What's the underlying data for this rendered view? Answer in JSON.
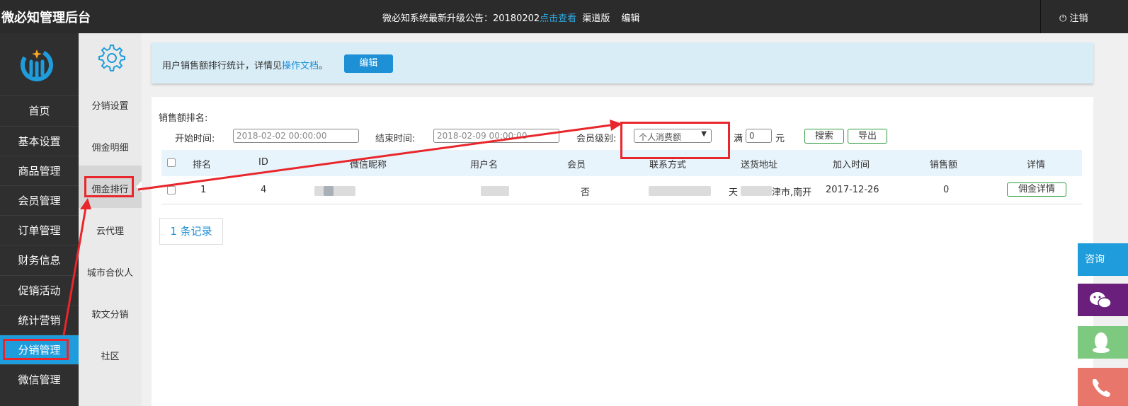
{
  "header": {
    "brand": "微必知管理后台",
    "notice_prefix": "微必知系统最新升级公告：20180202",
    "notice_link": "点击查看",
    "channel": "渠道版",
    "edit": "编辑",
    "logout": "注销"
  },
  "sidebar": {
    "items": [
      {
        "label": "首页"
      },
      {
        "label": "基本设置"
      },
      {
        "label": "商品管理"
      },
      {
        "label": "会员管理"
      },
      {
        "label": "订单管理"
      },
      {
        "label": "财务信息"
      },
      {
        "label": "促销活动"
      },
      {
        "label": "统计营销"
      },
      {
        "label": "分销管理",
        "active": true
      },
      {
        "label": "微信管理"
      }
    ]
  },
  "subnav": {
    "items": [
      {
        "label": "分销设置"
      },
      {
        "label": "佣金明细"
      },
      {
        "label": "佣金排行",
        "active": true
      },
      {
        "label": "云代理"
      },
      {
        "label": "城市合伙人"
      },
      {
        "label": "软文分销"
      },
      {
        "label": "社区"
      }
    ]
  },
  "info": {
    "text": "用户销售额排行统计，详情见",
    "link": "操作文档",
    "suffix": "。",
    "edit_button": "编辑"
  },
  "filters": {
    "section_title": "销售额排名:",
    "start_label": "开始时间:",
    "start_value": "2018-02-02 00:00:00",
    "end_label": "结束时间:",
    "end_value": "2018-02-09 00:00:00",
    "level_label": "会员级别:",
    "level_value": "个人消费额",
    "min_label": "满",
    "min_value": "0",
    "unit": "元",
    "search_button": "搜索",
    "export_button": "导出"
  },
  "table": {
    "headers": [
      "排名",
      "ID",
      "微信昵称",
      "用户名",
      "会员",
      "联系方式",
      "送货地址",
      "加入时间",
      "销售额",
      "详情"
    ],
    "rows": [
      {
        "rank": "1",
        "id": "4",
        "member": "否",
        "addr_a": "天",
        "addr_b": "津市,南开",
        "joined": "2017-12-26",
        "sales": "0",
        "detail": "佣金详情"
      }
    ]
  },
  "records": "1 条记录",
  "float": {
    "consult": "咨询"
  },
  "colors": {
    "topbar": "#2b2b2b",
    "sidebar": "#2f2f2f",
    "accent": "#1f9cdb",
    "annotation": "#e8262b"
  }
}
